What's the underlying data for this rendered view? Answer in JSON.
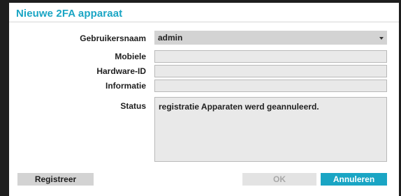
{
  "dialog": {
    "title": "Nieuwe 2FA apparaat"
  },
  "form": {
    "username_label": "Gebruikersnaam",
    "username_value": "admin",
    "mobile_label": "Mobiele",
    "mobile_value": "",
    "hardware_id_label": "Hardware-ID",
    "hardware_id_value": "",
    "info_label": "Informatie",
    "info_value": "",
    "status_label": "Status",
    "status_value": "registratie Apparaten werd geannuleerd."
  },
  "buttons": {
    "register_label": "Registreer",
    "ok_label": "OK",
    "cancel_label": "Annuleren"
  },
  "colors": {
    "accent": "#1aa5c4",
    "field_bg": "#e9e9e9",
    "button_bg": "#d3d3d3",
    "disabled_text": "#a8a8a8"
  }
}
